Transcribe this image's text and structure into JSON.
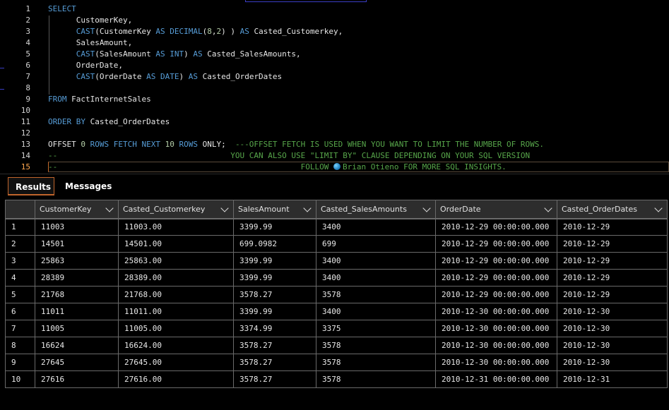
{
  "editor": {
    "lines": [
      {
        "n": "1",
        "parts": [
          {
            "c": "kw",
            "t": "SELECT"
          }
        ]
      },
      {
        "n": "2",
        "parts": [
          {
            "c": "tx",
            "t": "      CustomerKey,"
          }
        ]
      },
      {
        "n": "3",
        "parts": [
          {
            "c": "tx",
            "t": "      "
          },
          {
            "c": "kw",
            "t": "CAST"
          },
          {
            "c": "tx",
            "t": "(CustomerKey "
          },
          {
            "c": "kw",
            "t": "AS DECIMAL"
          },
          {
            "c": "tx",
            "t": "("
          },
          {
            "c": "nm",
            "t": "8"
          },
          {
            "c": "tx",
            "t": ","
          },
          {
            "c": "nm",
            "t": "2"
          },
          {
            "c": "tx",
            "t": ") ) "
          },
          {
            "c": "kw",
            "t": "AS"
          },
          {
            "c": "tx",
            "t": " Casted_Customerkey,"
          }
        ]
      },
      {
        "n": "4",
        "parts": [
          {
            "c": "tx",
            "t": "      SalesAmount,"
          }
        ]
      },
      {
        "n": "5",
        "parts": [
          {
            "c": "tx",
            "t": "      "
          },
          {
            "c": "kw",
            "t": "CAST"
          },
          {
            "c": "tx",
            "t": "(SalesAmount "
          },
          {
            "c": "kw",
            "t": "AS INT"
          },
          {
            "c": "tx",
            "t": ") "
          },
          {
            "c": "kw",
            "t": "AS"
          },
          {
            "c": "tx",
            "t": " Casted_SalesAmounts,"
          }
        ]
      },
      {
        "n": "6",
        "parts": [
          {
            "c": "tx",
            "t": "      OrderDate,"
          }
        ]
      },
      {
        "n": "7",
        "parts": [
          {
            "c": "tx",
            "t": "      "
          },
          {
            "c": "kw",
            "t": "CAST"
          },
          {
            "c": "tx",
            "t": "(OrderDate "
          },
          {
            "c": "kw",
            "t": "AS DATE"
          },
          {
            "c": "tx",
            "t": ") "
          },
          {
            "c": "kw",
            "t": "AS"
          },
          {
            "c": "tx",
            "t": " Casted_OrderDates"
          }
        ]
      },
      {
        "n": "8",
        "parts": []
      },
      {
        "n": "9",
        "parts": [
          {
            "c": "kw",
            "t": "FROM"
          },
          {
            "c": "tx",
            "t": " FactInternetSales"
          }
        ]
      },
      {
        "n": "10",
        "parts": []
      },
      {
        "n": "11",
        "parts": [
          {
            "c": "kw",
            "t": "ORDER BY"
          },
          {
            "c": "tx",
            "t": " Casted_OrderDates"
          }
        ]
      },
      {
        "n": "12",
        "parts": []
      },
      {
        "n": "13",
        "parts": [
          {
            "c": "tx",
            "t": "OFFSET "
          },
          {
            "c": "nm",
            "t": "0"
          },
          {
            "c": "kw",
            "t": " ROWS FETCH NEXT "
          },
          {
            "c": "nm",
            "t": "10"
          },
          {
            "c": "kw",
            "t": " ROWS"
          },
          {
            "c": "tx",
            "t": " ONLY;  "
          },
          {
            "c": "cm",
            "t": "---OFFSET FETCH IS USED WHEN YOU WANT TO LIMIT THE NUMBER OF ROWS."
          }
        ]
      },
      {
        "n": "14",
        "parts": [
          {
            "c": "cm",
            "t": "--                                     YOU CAN ALSO USE \"LIMIT BY\" CLAUSE DEPENDING ON YOUR SQL VERSION"
          }
        ]
      },
      {
        "n": "15",
        "active": true,
        "parts": [
          {
            "c": "cm",
            "t": "--                                                    FOLLOW "
          },
          {
            "c": "globe",
            "t": ""
          },
          {
            "c": "cm",
            "t": "Brian Otieno FOR MORE SQL INSIGHTS."
          }
        ]
      }
    ]
  },
  "results": {
    "tabs": {
      "results": "Results",
      "messages": "Messages"
    },
    "columns": [
      "CustomerKey",
      "Casted_Customerkey",
      "SalesAmount",
      "Casted_SalesAmounts",
      "OrderDate",
      "Casted_OrderDates"
    ],
    "rows": [
      [
        "1",
        "11003",
        "11003.00",
        "3399.99",
        "3400",
        "2010-12-29 00:00:00.000",
        "2010-12-29"
      ],
      [
        "2",
        "14501",
        "14501.00",
        "699.0982",
        "699",
        "2010-12-29 00:00:00.000",
        "2010-12-29"
      ],
      [
        "3",
        "25863",
        "25863.00",
        "3399.99",
        "3400",
        "2010-12-29 00:00:00.000",
        "2010-12-29"
      ],
      [
        "4",
        "28389",
        "28389.00",
        "3399.99",
        "3400",
        "2010-12-29 00:00:00.000",
        "2010-12-29"
      ],
      [
        "5",
        "21768",
        "21768.00",
        "3578.27",
        "3578",
        "2010-12-29 00:00:00.000",
        "2010-12-29"
      ],
      [
        "6",
        "11011",
        "11011.00",
        "3399.99",
        "3400",
        "2010-12-30 00:00:00.000",
        "2010-12-30"
      ],
      [
        "7",
        "11005",
        "11005.00",
        "3374.99",
        "3375",
        "2010-12-30 00:00:00.000",
        "2010-12-30"
      ],
      [
        "8",
        "16624",
        "16624.00",
        "3578.27",
        "3578",
        "2010-12-30 00:00:00.000",
        "2010-12-30"
      ],
      [
        "9",
        "27645",
        "27645.00",
        "3578.27",
        "3578",
        "2010-12-30 00:00:00.000",
        "2010-12-30"
      ],
      [
        "10",
        "27616",
        "27616.00",
        "3578.27",
        "3578",
        "2010-12-31 00:00:00.000",
        "2010-12-31"
      ]
    ]
  }
}
